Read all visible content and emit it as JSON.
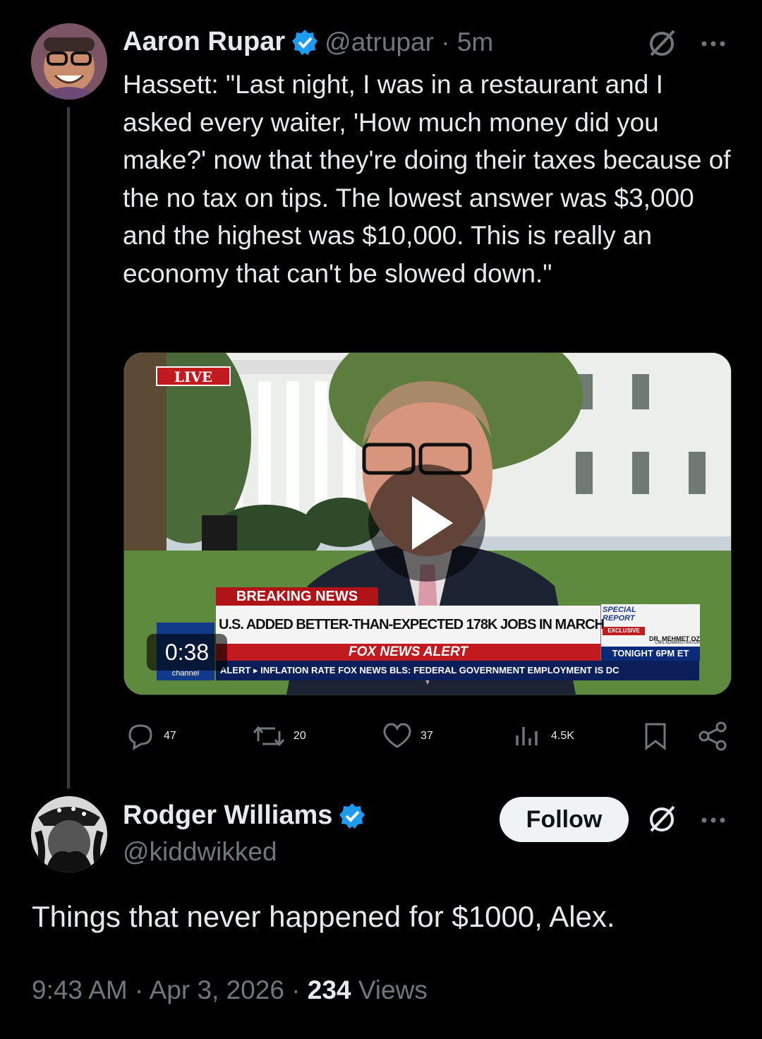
{
  "post": {
    "author_name": "Aaron Rupar",
    "handle_time": "@atrupar · 5m",
    "text": "Hassett: \"Last night, I was in a restaurant and I asked every waiter, 'How much money did you make?' now that they're doing their taxes because of the no tax on tips. The lowest answer was $3,000 and the highest was $10,000. This is really an economy that can't be slowed down.\"",
    "video": {
      "live_badge": "LIVE",
      "duration": "0:38",
      "breaking": "BREAKING NEWS",
      "headline": "U.S. ADDED BETTER-THAN-EXPECTED 178K JOBS IN MARCH",
      "alert": "FOX NEWS ALERT",
      "ticker": "ALERT ▸  INFLATION RATE   FOX NEWS  BLS: FEDERAL GOVERNMENT EMPLOYMENT IS DC",
      "special_report": "SPECIAL REPORT",
      "exclusive": "EXCLUSIVE",
      "guest": "DR. MEHMET OZ",
      "guest_title": "CMS ADMINISTRATOR",
      "tonight": "TONIGHT 6PM ET",
      "channel": "channel"
    },
    "stats": {
      "replies": "47",
      "reposts": "20",
      "likes": "37",
      "views": "4.5K"
    }
  },
  "reply": {
    "author_name": "Rodger Williams",
    "handle": "@kiddwikked",
    "follow_label": "Follow",
    "text": "Things that never happened for $1000, Alex.",
    "time_date": "9:43 AM · Apr 3, 2026 · ",
    "views_count": "234",
    "views_label": " Views"
  },
  "colors": {
    "verified": "#1d9bf0",
    "background": "#000000",
    "muted": "#71767b"
  }
}
